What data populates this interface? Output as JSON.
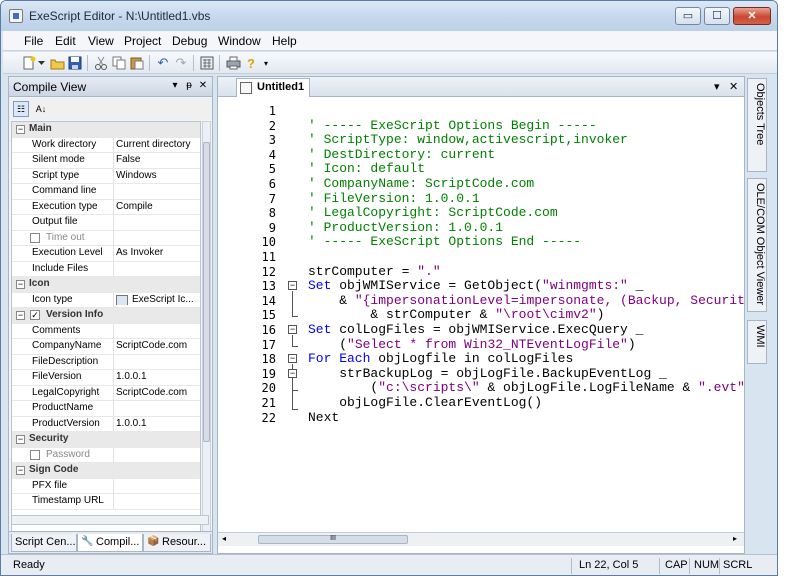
{
  "window": {
    "title": "ExeScript Editor - N:\\Untitled1.vbs",
    "controls": {
      "minimize": "▭",
      "maximize": "☐",
      "close": "✕"
    }
  },
  "menu": [
    "File",
    "Edit",
    "View",
    "Project",
    "Debug",
    "Window",
    "Help"
  ],
  "toolbar": {
    "icons": [
      "new-file-icon",
      "dropdown-icon",
      "open-folder-icon",
      "save-icon",
      "cut-icon",
      "copy-icon",
      "paste-icon",
      "undo-icon",
      "redo-icon",
      "calculator-icon",
      "print-icon",
      "help-icon",
      "toolbar-options-icon"
    ]
  },
  "left_panel": {
    "title": "Compile View",
    "controls": {
      "dropdown": "▾",
      "pin": "ᵽ",
      "close": "✕"
    },
    "tools": {
      "categorized": "☷",
      "alphabetical": "A↓"
    },
    "rows": [
      {
        "type": "cat",
        "key": "Main",
        "sign": "−"
      },
      {
        "key": "Work directory",
        "value": "Current directory"
      },
      {
        "key": "Silent mode",
        "value": "False"
      },
      {
        "key": "Script type",
        "value": "Windows"
      },
      {
        "key": "Command line",
        "value": ""
      },
      {
        "key": "Execution type",
        "value": "Compile"
      },
      {
        "key": "Output file",
        "value": ""
      },
      {
        "type": "check",
        "key": "Time out",
        "checked": "",
        "value": ""
      },
      {
        "key": "Execution Level",
        "value": "As Invoker"
      },
      {
        "key": "Include Files",
        "value": ""
      },
      {
        "type": "cat",
        "key": "Icon",
        "sign": "−"
      },
      {
        "key": "Icon type",
        "value": "ExeScript Ic..."
      },
      {
        "type": "catcheck",
        "key": "Version Info",
        "sign": "−",
        "checked": "✓"
      },
      {
        "key": "Comments",
        "value": ""
      },
      {
        "key": "CompanyName",
        "value": "ScriptCode.com"
      },
      {
        "key": "FileDescription",
        "value": ""
      },
      {
        "key": "FileVersion",
        "value": "1.0.0.1"
      },
      {
        "key": "LegalCopyright",
        "value": "ScriptCode.com"
      },
      {
        "key": "ProductName",
        "value": ""
      },
      {
        "key": "ProductVersion",
        "value": "1.0.0.1"
      },
      {
        "type": "cat",
        "key": "Security",
        "sign": "−"
      },
      {
        "type": "check",
        "key": "Password",
        "checked": "",
        "value": ""
      },
      {
        "type": "cat",
        "key": "Sign Code",
        "sign": "−"
      },
      {
        "key": "PFX file",
        "value": ""
      },
      {
        "key": "Timestamp URL",
        "value": ""
      }
    ],
    "tabs": [
      {
        "label": "Script Cen...",
        "active": false
      },
      {
        "label": "Compil...",
        "active": true
      },
      {
        "label": "Resour...",
        "active": false
      }
    ]
  },
  "editor": {
    "tab_label": "Untitled1",
    "controls": {
      "dropdown": "▾",
      "close": "✕"
    },
    "lines": [
      {
        "n": "1",
        "segs": [
          {
            "t": "",
            "c": "#000"
          }
        ]
      },
      {
        "n": "2",
        "segs": [
          {
            "t": "' ----- ExeScript Options Begin -----",
            "c": "#008000"
          }
        ]
      },
      {
        "n": "3",
        "segs": [
          {
            "t": "' ScriptType: window,activescript,invoker",
            "c": "#008000"
          }
        ]
      },
      {
        "n": "4",
        "segs": [
          {
            "t": "' DestDirectory: current",
            "c": "#008000"
          }
        ]
      },
      {
        "n": "5",
        "segs": [
          {
            "t": "' Icon: default",
            "c": "#008000"
          }
        ]
      },
      {
        "n": "6",
        "segs": [
          {
            "t": "' CompanyName: ScriptCode.com",
            "c": "#008000"
          }
        ]
      },
      {
        "n": "7",
        "segs": [
          {
            "t": "' FileVersion: 1.0.0.1",
            "c": "#008000"
          }
        ]
      },
      {
        "n": "8",
        "segs": [
          {
            "t": "' LegalCopyright: ScriptCode.com",
            "c": "#008000"
          }
        ]
      },
      {
        "n": "9",
        "segs": [
          {
            "t": "' ProductVersion: 1.0.0.1",
            "c": "#008000"
          }
        ]
      },
      {
        "n": "10",
        "segs": [
          {
            "t": "' ----- ExeScript Options End -----",
            "c": "#008000"
          }
        ]
      },
      {
        "n": "11",
        "segs": [
          {
            "t": "",
            "c": "#000"
          }
        ]
      },
      {
        "n": "12",
        "segs": [
          {
            "t": "strComputer = ",
            "c": "#000"
          },
          {
            "t": "\".\"",
            "c": "#800080"
          }
        ]
      },
      {
        "n": "13",
        "segs": [
          {
            "t": "Set",
            "c": "#0000ff"
          },
          {
            "t": " objWMIService = GetObject(",
            "c": "#000"
          },
          {
            "t": "\"winmgmts:\"",
            "c": "#800080"
          },
          {
            "t": " _",
            "c": "#000"
          }
        ]
      },
      {
        "n": "14",
        "segs": [
          {
            "t": "    & ",
            "c": "#000"
          },
          {
            "t": "\"{impersonationLevel=impersonate, (Backup, Security)}!\\\\\"",
            "c": "#800080"
          },
          {
            "t": " _",
            "c": "#000"
          }
        ]
      },
      {
        "n": "15",
        "segs": [
          {
            "t": "        & strComputer & ",
            "c": "#000"
          },
          {
            "t": "\"\\root\\cimv2\"",
            "c": "#800080"
          },
          {
            "t": ")",
            "c": "#000"
          }
        ]
      },
      {
        "n": "16",
        "segs": [
          {
            "t": "Set",
            "c": "#0000ff"
          },
          {
            "t": " colLogFiles = objWMIService.ExecQuery _",
            "c": "#000"
          }
        ]
      },
      {
        "n": "17",
        "segs": [
          {
            "t": "    (",
            "c": "#000"
          },
          {
            "t": "\"Select * from Win32_NTEventLogFile\"",
            "c": "#800080"
          },
          {
            "t": ")",
            "c": "#000"
          }
        ]
      },
      {
        "n": "18",
        "segs": [
          {
            "t": "For Each",
            "c": "#0000ff"
          },
          {
            "t": " objLogfile in colLogFiles",
            "c": "#000"
          }
        ]
      },
      {
        "n": "19",
        "segs": [
          {
            "t": "    strBackupLog = objLogFile.BackupEventLog _",
            "c": "#000"
          }
        ]
      },
      {
        "n": "20",
        "segs": [
          {
            "t": "        (",
            "c": "#000"
          },
          {
            "t": "\"c:\\scripts\\\"",
            "c": "#800080"
          },
          {
            "t": " & objLogFile.LogFileName & ",
            "c": "#000"
          },
          {
            "t": "\".evt\"",
            "c": "#800080"
          },
          {
            "t": ")",
            "c": "#000"
          }
        ]
      },
      {
        "n": "21",
        "segs": [
          {
            "t": "    objLogFile.ClearEventLog()",
            "c": "#000"
          }
        ]
      },
      {
        "n": "22",
        "segs": [
          {
            "t": "Next",
            "c": "#000"
          }
        ]
      }
    ],
    "scroll_grip": "III"
  },
  "right_tabs": [
    "Objects Tree",
    "OLE/COM Object Viewer",
    "WMI"
  ],
  "status": {
    "text": "Ready",
    "position_label": "Ln  22, Col  5",
    "cap": "CAP",
    "num": "NUM",
    "scrl": "SCRL"
  },
  "colors": {
    "comment": "#008000",
    "keyword": "#0000ff",
    "string": "#800080"
  }
}
